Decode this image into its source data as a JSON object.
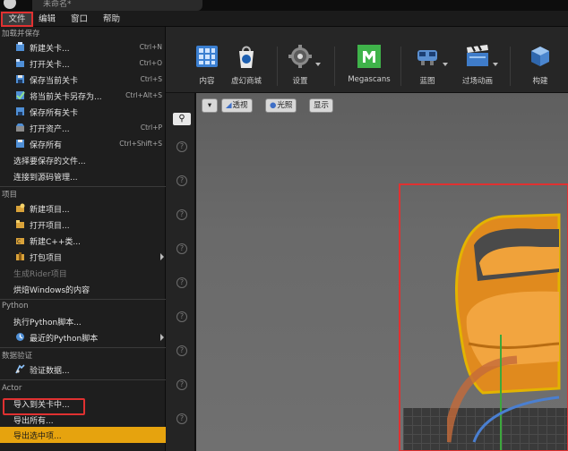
{
  "window": {
    "doc_tab": "未命名*"
  },
  "menubar": {
    "items": [
      "文件",
      "编辑",
      "窗口",
      "帮助"
    ]
  },
  "file_menu": {
    "sections": [
      {
        "title": "加载并保存",
        "items": [
          {
            "label": "新建关卡...",
            "shortcut": "Ctrl+N",
            "icon": "new-level-icon"
          },
          {
            "label": "打开关卡...",
            "shortcut": "Ctrl+O",
            "icon": "open-level-icon"
          },
          {
            "label": "保存当前关卡",
            "shortcut": "Ctrl+S",
            "icon": "save-icon"
          },
          {
            "label": "将当前关卡另存为...",
            "shortcut": "Ctrl+Alt+S",
            "icon": "save-as-icon"
          },
          {
            "label": "保存所有关卡",
            "shortcut": "",
            "icon": "save-all-levels-icon"
          },
          {
            "label": "打开资产...",
            "shortcut": "Ctrl+P",
            "icon": "open-asset-icon"
          },
          {
            "label": "保存所有",
            "shortcut": "Ctrl+Shift+S",
            "icon": "save-all-icon"
          },
          {
            "label": "选择要保存的文件...",
            "shortcut": "",
            "icon": ""
          },
          {
            "label": "连接到源码管理...",
            "shortcut": "",
            "icon": ""
          }
        ]
      },
      {
        "title": "项目",
        "items": [
          {
            "label": "新建项目...",
            "icon": "new-project-icon"
          },
          {
            "label": "打开项目...",
            "icon": "open-project-icon"
          },
          {
            "label": "新建C++类...",
            "icon": "new-cpp-class-icon"
          },
          {
            "label": "打包项目",
            "icon": "package-project-icon",
            "submenu": true
          },
          {
            "label": "生成Rider项目",
            "icon": "",
            "disabled": true
          },
          {
            "label": "烘焙Windows的内容",
            "icon": ""
          }
        ]
      },
      {
        "title": "Python",
        "items": [
          {
            "label": "执行Python脚本...",
            "icon": ""
          },
          {
            "label": "最近的Python脚本",
            "icon": "python-recent-icon",
            "submenu": true
          }
        ]
      },
      {
        "title": "数据验证",
        "items": [
          {
            "label": "验证数据...",
            "icon": "validate-data-icon"
          }
        ]
      },
      {
        "title": "Actor",
        "items": [
          {
            "label": "导入到关卡中...",
            "icon": ""
          },
          {
            "label": "导出所有...",
            "icon": ""
          },
          {
            "label": "导出选中项...",
            "icon": "",
            "highlighted": true
          }
        ]
      }
    ]
  },
  "toolbar": {
    "buttons": [
      {
        "label": "内容",
        "icon": "content-browser-icon"
      },
      {
        "label": "虚幻商城",
        "icon": "marketplace-icon"
      },
      {
        "label": "设置",
        "icon": "settings-icon"
      },
      {
        "label": "Megascans",
        "icon": "megascans-icon"
      },
      {
        "label": "蓝图",
        "icon": "blueprints-icon"
      },
      {
        "label": "过场动画",
        "icon": "cinematics-icon"
      },
      {
        "label": "构建",
        "icon": "build-icon"
      }
    ]
  },
  "viewport": {
    "buttons": [
      {
        "label": "透视",
        "icon": "perspective-icon"
      },
      {
        "label": "光照",
        "icon": "lit-icon"
      },
      {
        "label": "显示",
        "icon": ""
      }
    ]
  },
  "colors": {
    "highlight": "#e6a30e",
    "annotation_red": "#e03131",
    "megascans_green": "#3fb34a",
    "chair_orange": "#e08a1e"
  }
}
